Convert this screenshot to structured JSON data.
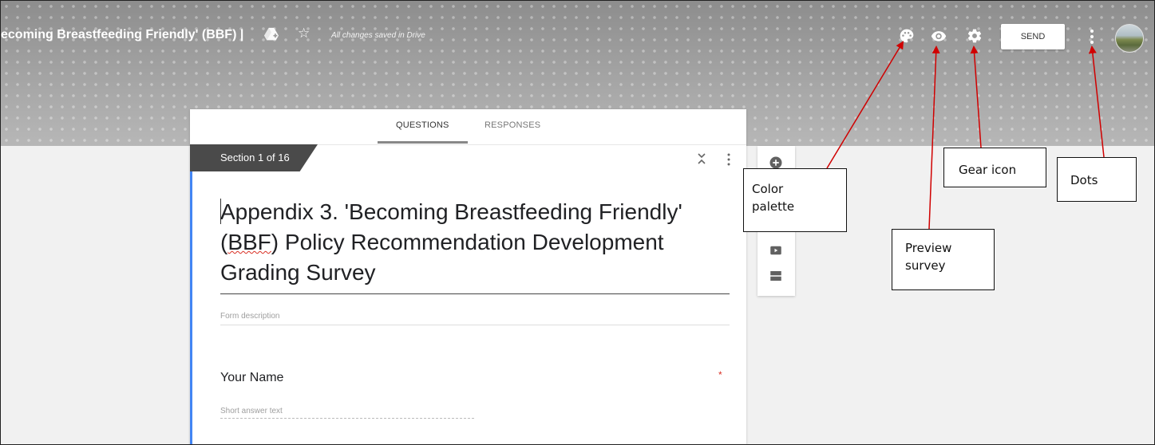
{
  "header": {
    "doc_title": "ecoming Breastfeeding Friendly' (BBF) |",
    "saved_status": "All changes saved in Drive",
    "send_label": "SEND"
  },
  "tabs": [
    {
      "label": "QUESTIONS",
      "active": true
    },
    {
      "label": "RESPONSES",
      "active": false
    }
  ],
  "section": {
    "label": "Section 1 of 16"
  },
  "form": {
    "title_line1": "Appendix 3. 'Becoming Breastfeeding Friendly'",
    "title_line2_prefix": "(",
    "title_line2_abbrev": "BBF",
    "title_line2_rest": ") Policy Recommendation Development",
    "title_line3": "Grading Survey",
    "description_placeholder": "Form description"
  },
  "question": {
    "title": "Your Name",
    "required_marker": "*",
    "placeholder": "Short answer text"
  },
  "side_toolbar": {
    "icons": [
      "add-question-icon",
      "add-video-icon",
      "add-section-icon"
    ]
  },
  "callouts": {
    "palette_line1": "Color",
    "palette_line2": "palette",
    "preview_line1": "Preview",
    "preview_line2": "survey",
    "gear": "Gear icon",
    "dots": "Dots"
  },
  "colors": {
    "accent": "#4285f4",
    "section_tag": "#4a4a4a",
    "arrow": "#d00000",
    "required": "#d93025"
  }
}
